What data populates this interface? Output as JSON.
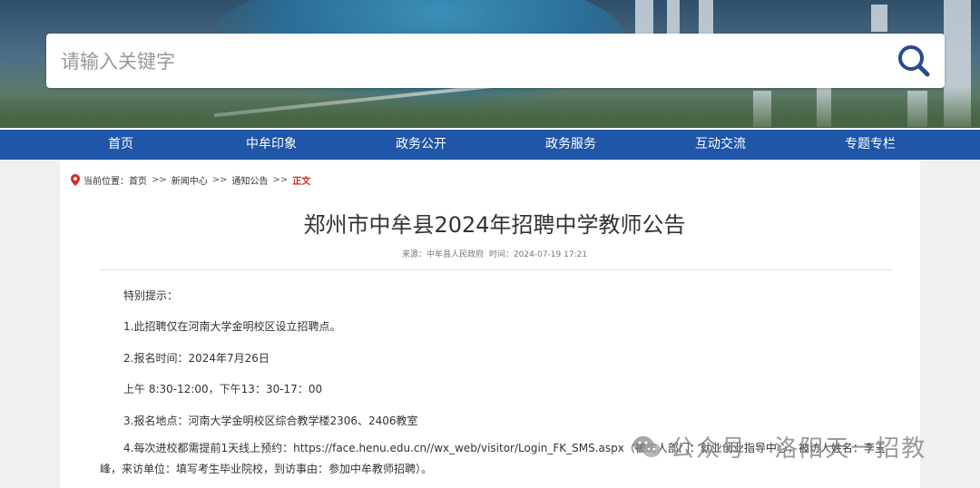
{
  "search": {
    "placeholder": "请输入关键字",
    "value": ""
  },
  "nav": {
    "items": [
      {
        "label": "首页"
      },
      {
        "label": "中牟印象"
      },
      {
        "label": "政务公开"
      },
      {
        "label": "政务服务"
      },
      {
        "label": "互动交流"
      },
      {
        "label": "专题专栏"
      }
    ]
  },
  "breadcrumb": {
    "prefix": "当前位置：",
    "items": [
      "首页",
      "新闻中心",
      "通知公告"
    ],
    "separator": ">>",
    "current": "正文"
  },
  "article": {
    "title": "郑州市中牟县2024年招聘中学教师公告",
    "source": "来源：中牟县人民政府",
    "time": "时间：2024-07-19 17:21",
    "paragraphs": [
      "特别提示：",
      "1.此招聘仅在河南大学金明校区设立招聘点。",
      "2.报名时间：2024年7月26日",
      "上午 8:30-12:00，下午13：30-17：00",
      "3.报名地点：河南大学金明校区综合教学楼2306、2406教室",
      "4.每次进校都需提前1天线上预约：https://face.henu.edu.cn//wx_web/visitor/Login_FK_SMS.aspx（被访人部门：就业创业指导中心，被访人姓名：李玉峰，来访单位：填写考生毕业院校，到访事由：参加中牟教师招聘）。"
    ]
  },
  "watermark": {
    "text_left": "公众号",
    "separator": "·",
    "text_right": "洛阳天一招教"
  },
  "colors": {
    "nav_bg": "#1f56a8",
    "breadcrumb_current": "#d6281e",
    "search_icon": "#2a4a8c"
  },
  "icons": {
    "search": "search-icon",
    "location": "location-pin-icon",
    "wechat": "wechat-icon"
  }
}
